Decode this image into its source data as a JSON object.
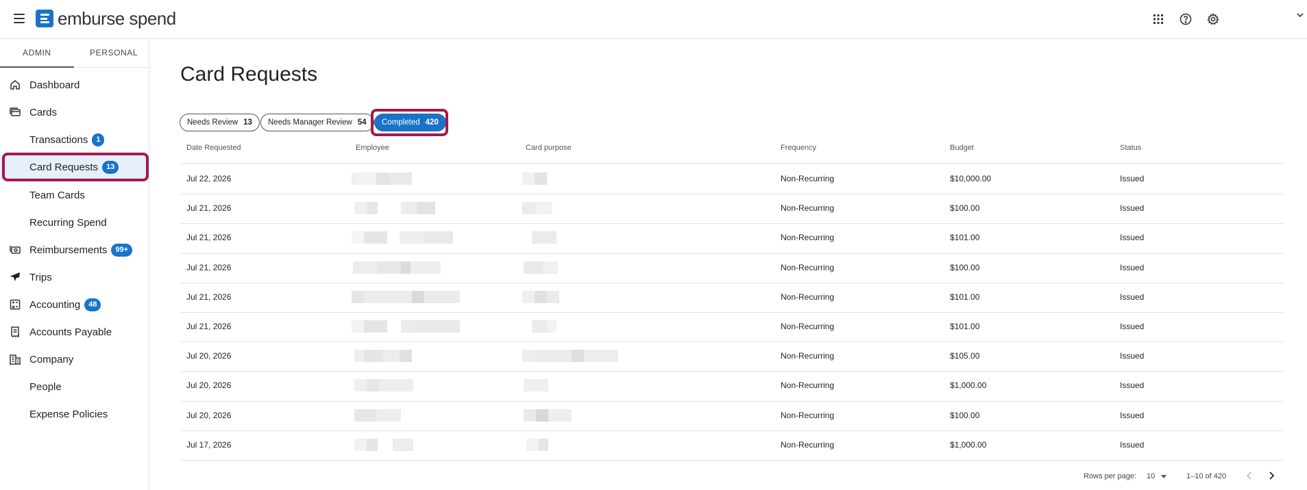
{
  "app": {
    "brand": "emburse spend",
    "accent": "#1a73c9",
    "highlight": "#a3194f"
  },
  "header": {
    "icons": [
      "apps-grid-icon",
      "help-icon",
      "settings-gear-icon",
      "chevron-down-icon"
    ]
  },
  "sidebar": {
    "tabs": [
      "ADMIN",
      "PERSONAL"
    ],
    "active_tab": "ADMIN",
    "items": [
      {
        "label": "Dashboard",
        "icon": "home-icon",
        "badge": ""
      },
      {
        "label": "Cards",
        "icon": "card-icon",
        "badge": ""
      },
      {
        "label": "Transactions",
        "icon": "",
        "badge": "1"
      },
      {
        "label": "Card Requests",
        "icon": "",
        "badge": "13",
        "active": true
      },
      {
        "label": "Team Cards",
        "icon": "",
        "badge": ""
      },
      {
        "label": "Recurring Spend",
        "icon": "",
        "badge": ""
      },
      {
        "label": "Reimbursements",
        "icon": "cash-icon",
        "badge": "99+"
      },
      {
        "label": "Trips",
        "icon": "plane-icon",
        "badge": ""
      },
      {
        "label": "Accounting",
        "icon": "accounting-icon",
        "badge": "48"
      },
      {
        "label": "Accounts Payable",
        "icon": "invoice-icon",
        "badge": ""
      },
      {
        "label": "Company",
        "icon": "building-icon",
        "badge": ""
      },
      {
        "label": "People",
        "icon": "",
        "badge": ""
      },
      {
        "label": "Expense Policies",
        "icon": "",
        "badge": ""
      }
    ]
  },
  "main": {
    "title": "Card Requests",
    "filters": [
      {
        "label": "Needs Review",
        "count": "13"
      },
      {
        "label": "Needs Manager Review",
        "count": "54"
      },
      {
        "label": "Completed",
        "count": "420",
        "active": true
      }
    ],
    "columns": [
      "Date Requested",
      "Employee",
      "Card purpose",
      "Frequency",
      "Budget",
      "Status"
    ],
    "rows": [
      {
        "date": "Jul 22, 2026",
        "frequency": "Non-Recurring",
        "budget": "$10,000.00",
        "status": "Issued"
      },
      {
        "date": "Jul 21, 2026",
        "frequency": "Non-Recurring",
        "budget": "$100.00",
        "status": "Issued"
      },
      {
        "date": "Jul 21, 2026",
        "frequency": "Non-Recurring",
        "budget": "$101.00",
        "status": "Issued"
      },
      {
        "date": "Jul 21, 2026",
        "frequency": "Non-Recurring",
        "budget": "$100.00",
        "status": "Issued"
      },
      {
        "date": "Jul 21, 2026",
        "frequency": "Non-Recurring",
        "budget": "$101.00",
        "status": "Issued"
      },
      {
        "date": "Jul 21, 2026",
        "frequency": "Non-Recurring",
        "budget": "$101.00",
        "status": "Issued"
      },
      {
        "date": "Jul 20, 2026",
        "frequency": "Non-Recurring",
        "budget": "$105.00",
        "status": "Issued"
      },
      {
        "date": "Jul 20, 2026",
        "frequency": "Non-Recurring",
        "budget": "$1,000.00",
        "status": "Issued"
      },
      {
        "date": "Jul 20, 2026",
        "frequency": "Non-Recurring",
        "budget": "$100.00",
        "status": "Issued"
      },
      {
        "date": "Jul 17, 2026",
        "frequency": "Non-Recurring",
        "budget": "$1,000.00",
        "status": "Issued"
      }
    ],
    "pagination": {
      "rows_per_page_label": "Rows per page:",
      "rows_per_page": "10",
      "range": "1–10 of 420"
    }
  }
}
